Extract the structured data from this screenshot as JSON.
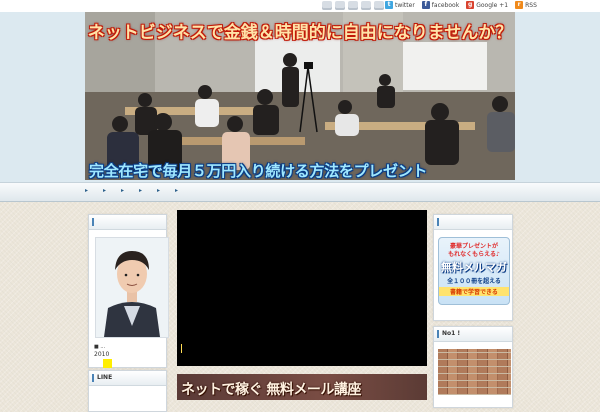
{
  "top_links": {
    "twitter": "twitter",
    "facebook": "facebook",
    "google": "Google +1",
    "rss": "RSS"
  },
  "banner": {
    "title": "ネットビジネスで金銭＆時間的に自由になりませんか？",
    "subtitle": "完全在宅で毎月５万円入り続ける方法をプレゼント"
  },
  "nav": {
    "items": [
      "▸",
      "▸",
      "▸",
      "▸",
      "▸",
      "▸"
    ]
  },
  "profile": {
    "dots": "■ ...",
    "year": "2010"
  },
  "sidebar_left": {
    "line_title": "LINE"
  },
  "ad": {
    "line1": "豪華プレゼントが",
    "line2": "もれなくもらえる♪",
    "line3": "無料メルマガ",
    "line4": "全１００冊を超える",
    "line5": "書籍で学習できる"
  },
  "sidebar_right": {
    "no1_title": "No1 !"
  },
  "main": {
    "mail_banner": "ネットで稼ぐ 無料メール講座"
  },
  "colors": {
    "header_band": "#dce9f0",
    "title_outline": "#c21806",
    "subtitle_outline": "#0a3d86",
    "video_bg": "#000000"
  }
}
